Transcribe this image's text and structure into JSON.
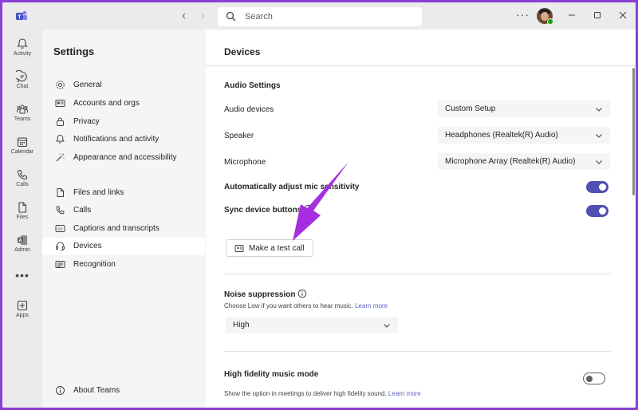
{
  "search": {
    "placeholder": "Search"
  },
  "rail": {
    "items": [
      {
        "label": "Activity",
        "icon": "bell-icon"
      },
      {
        "label": "Chat",
        "icon": "chat-icon"
      },
      {
        "label": "Teams",
        "icon": "teams-icon"
      },
      {
        "label": "Calendar",
        "icon": "calendar-icon"
      },
      {
        "label": "Calls",
        "icon": "phone-icon"
      },
      {
        "label": "Files",
        "icon": "file-icon"
      },
      {
        "label": "Admin",
        "icon": "admin-icon"
      },
      {
        "label": "Apps",
        "icon": "plus-square-icon"
      }
    ],
    "more": "•••"
  },
  "settings": {
    "title": "Settings",
    "items": [
      {
        "label": "General",
        "icon": "gear-icon"
      },
      {
        "label": "Accounts and orgs",
        "icon": "id-card-icon"
      },
      {
        "label": "Privacy",
        "icon": "lock-icon"
      },
      {
        "label": "Notifications and activity",
        "icon": "bell-icon"
      },
      {
        "label": "Appearance and accessibility",
        "icon": "wand-icon"
      },
      {
        "label": "Files and links",
        "icon": "document-icon"
      },
      {
        "label": "Calls",
        "icon": "phone-icon"
      },
      {
        "label": "Captions and transcripts",
        "icon": "cc-icon"
      },
      {
        "label": "Devices",
        "icon": "headset-icon"
      },
      {
        "label": "Recognition",
        "icon": "picture-icon"
      },
      {
        "label": "About Teams",
        "icon": "info-icon"
      }
    ],
    "active": "Devices"
  },
  "content": {
    "title": "Devices",
    "audio_settings": "Audio Settings",
    "audio_devices": {
      "label": "Audio devices",
      "value": "Custom Setup"
    },
    "speaker": {
      "label": "Speaker",
      "value": "Headphones (Realtek(R) Audio)"
    },
    "microphone": {
      "label": "Microphone",
      "value": "Microphone Array (Realtek(R) Audio)"
    },
    "auto_adjust": {
      "label": "Automatically adjust mic sensitivity",
      "on": true
    },
    "sync_buttons": {
      "label": "Sync device buttons",
      "on": true
    },
    "test_call": "Make a test call",
    "noise": {
      "title": "Noise suppression",
      "helper": "Choose Low if you want others to hear music.",
      "learn_more": "Learn more",
      "value": "High"
    },
    "hifi": {
      "title": "High fidelity music mode",
      "helper": "Show the option in meetings to deliver high fidelity sound.",
      "learn_more": "Learn more",
      "on": false
    }
  },
  "colors": {
    "accent": "#4f52b2",
    "frame": "#8a3fd0",
    "arrow": "#a52fe0"
  }
}
